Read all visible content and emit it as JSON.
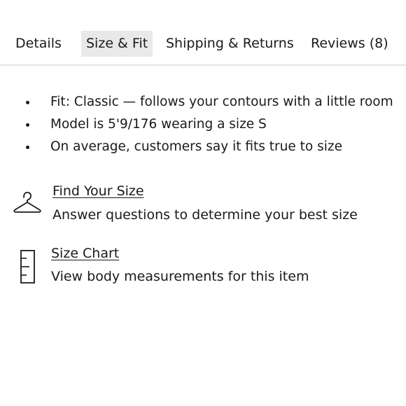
{
  "tabs": [
    {
      "label": "Details",
      "active": false
    },
    {
      "label": "Size & Fit",
      "active": true
    },
    {
      "label": "Shipping & Returns",
      "active": false
    },
    {
      "label": "Reviews (8)",
      "active": false
    }
  ],
  "fit_notes": [
    "Fit: Classic — follows your contours with a little room",
    "Model is 5'9/176 wearing a size S",
    "On average, customers say it fits true to size"
  ],
  "find_size": {
    "icon": "hanger-icon",
    "link_label": "Find Your Size",
    "description": "Answer questions to determine your best size"
  },
  "size_chart": {
    "icon": "ruler-icon",
    "link_label": "Size Chart",
    "description": "View body measurements for this item"
  },
  "colors": {
    "text": "#1a1a1a",
    "active_tab_bg": "#e9e9e9",
    "divider": "#e6e6e6"
  }
}
